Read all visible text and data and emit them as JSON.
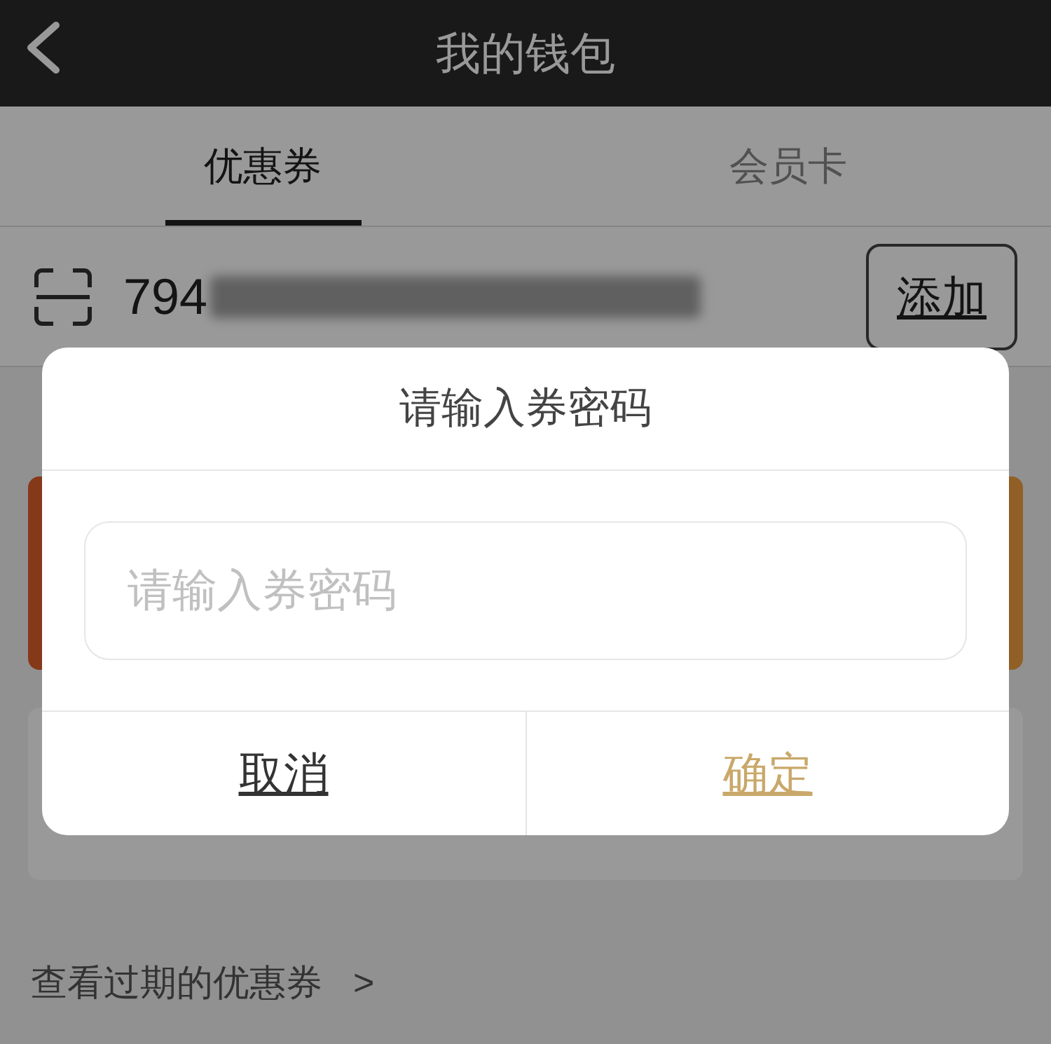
{
  "header": {
    "title": "我的钱包"
  },
  "tabs": [
    {
      "label": "优惠券",
      "selected": true
    },
    {
      "label": "会员卡",
      "selected": false
    }
  ],
  "code_entry": {
    "value": "794",
    "button": "添加"
  },
  "expired_link": {
    "label": "查看过期的优惠券",
    "chevron": ">"
  },
  "dialog": {
    "title": "请输入券密码",
    "placeholder": "请输入券密码",
    "buttons": [
      {
        "label": "取消",
        "kind": "cancel"
      },
      {
        "label": "确定",
        "kind": "confirm"
      }
    ]
  }
}
